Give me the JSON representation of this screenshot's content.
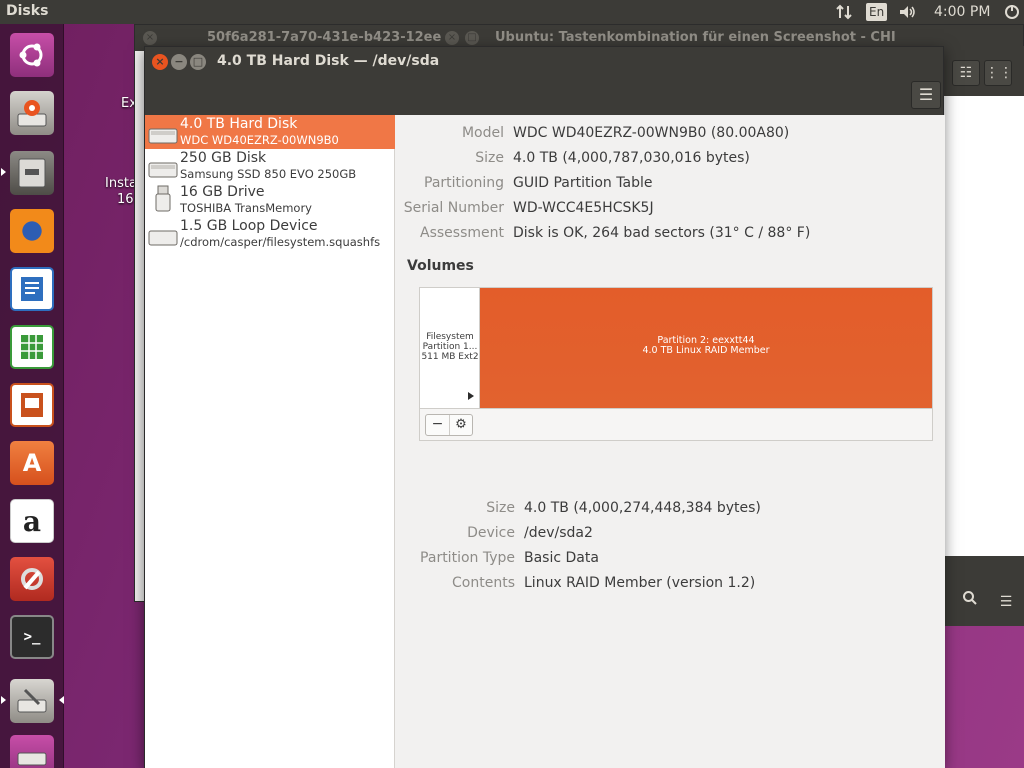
{
  "top_panel": {
    "app_name": "Disks",
    "keyboard_layout": "En",
    "time": "4:00 PM"
  },
  "desktop": {
    "icon1_label": "Ex",
    "icon2_line1": "Insta",
    "icon2_line2": "16"
  },
  "background_window": {
    "tab1_title": "50f6a281-7a70-431e-b423-12ee",
    "title": "Ubuntu: Tastenkombination für einen Screenshot - CHI"
  },
  "disks_window": {
    "title": "4.0 TB Hard Disk — /dev/sda",
    "menu_icon": "☰"
  },
  "drives": [
    {
      "name": "4.0 TB Hard Disk",
      "detail": "WDC WD40EZRZ-00WN9B0",
      "icon": "hard-disk-icon",
      "selected": true
    },
    {
      "name": "250 GB Disk",
      "detail": "Samsung SSD 850 EVO 250GB",
      "icon": "hard-disk-icon",
      "selected": false
    },
    {
      "name": "16 GB Drive",
      "detail": "TOSHIBA TransMemory",
      "icon": "usb-drive-icon",
      "selected": false
    },
    {
      "name": "1.5 GB Loop Device",
      "detail": "/cdrom/casper/filesystem.squashfs",
      "icon": "loop-device-icon",
      "selected": false
    }
  ],
  "disk_info": {
    "model_label": "Model",
    "model": "WDC WD40EZRZ-00WN9B0 (80.00A80)",
    "size_label": "Size",
    "size": "4.0 TB (4,000,787,030,016 bytes)",
    "partitioning_label": "Partitioning",
    "partitioning": "GUID Partition Table",
    "serial_label": "Serial Number",
    "serial": "WD-WCC4E5HCSK5J",
    "assessment_label": "Assessment",
    "assessment": "Disk is OK, 264 bad sectors (31° C / 88° F)"
  },
  "volumes": {
    "heading": "Volumes",
    "partition1": {
      "line1": "Filesystem",
      "line2": "Partition 1...",
      "line3": "511 MB Ext2"
    },
    "partition2": {
      "line1": "Partition 2: eexxtt44",
      "line2": "4.0 TB Linux RAID Member"
    },
    "minus_label": "−",
    "gear_label": "⚙"
  },
  "partition_info": {
    "size_label": "Size",
    "size": "4.0 TB (4,000,274,448,384 bytes)",
    "device_label": "Device",
    "device": "/dev/sda2",
    "type_label": "Partition Type",
    "type": "Basic Data",
    "contents_label": "Contents",
    "contents": "Linux RAID Member (version 1.2)"
  },
  "colors": {
    "accent": "#e95420",
    "selection": "#f07746",
    "panel": "#3c3b37"
  }
}
